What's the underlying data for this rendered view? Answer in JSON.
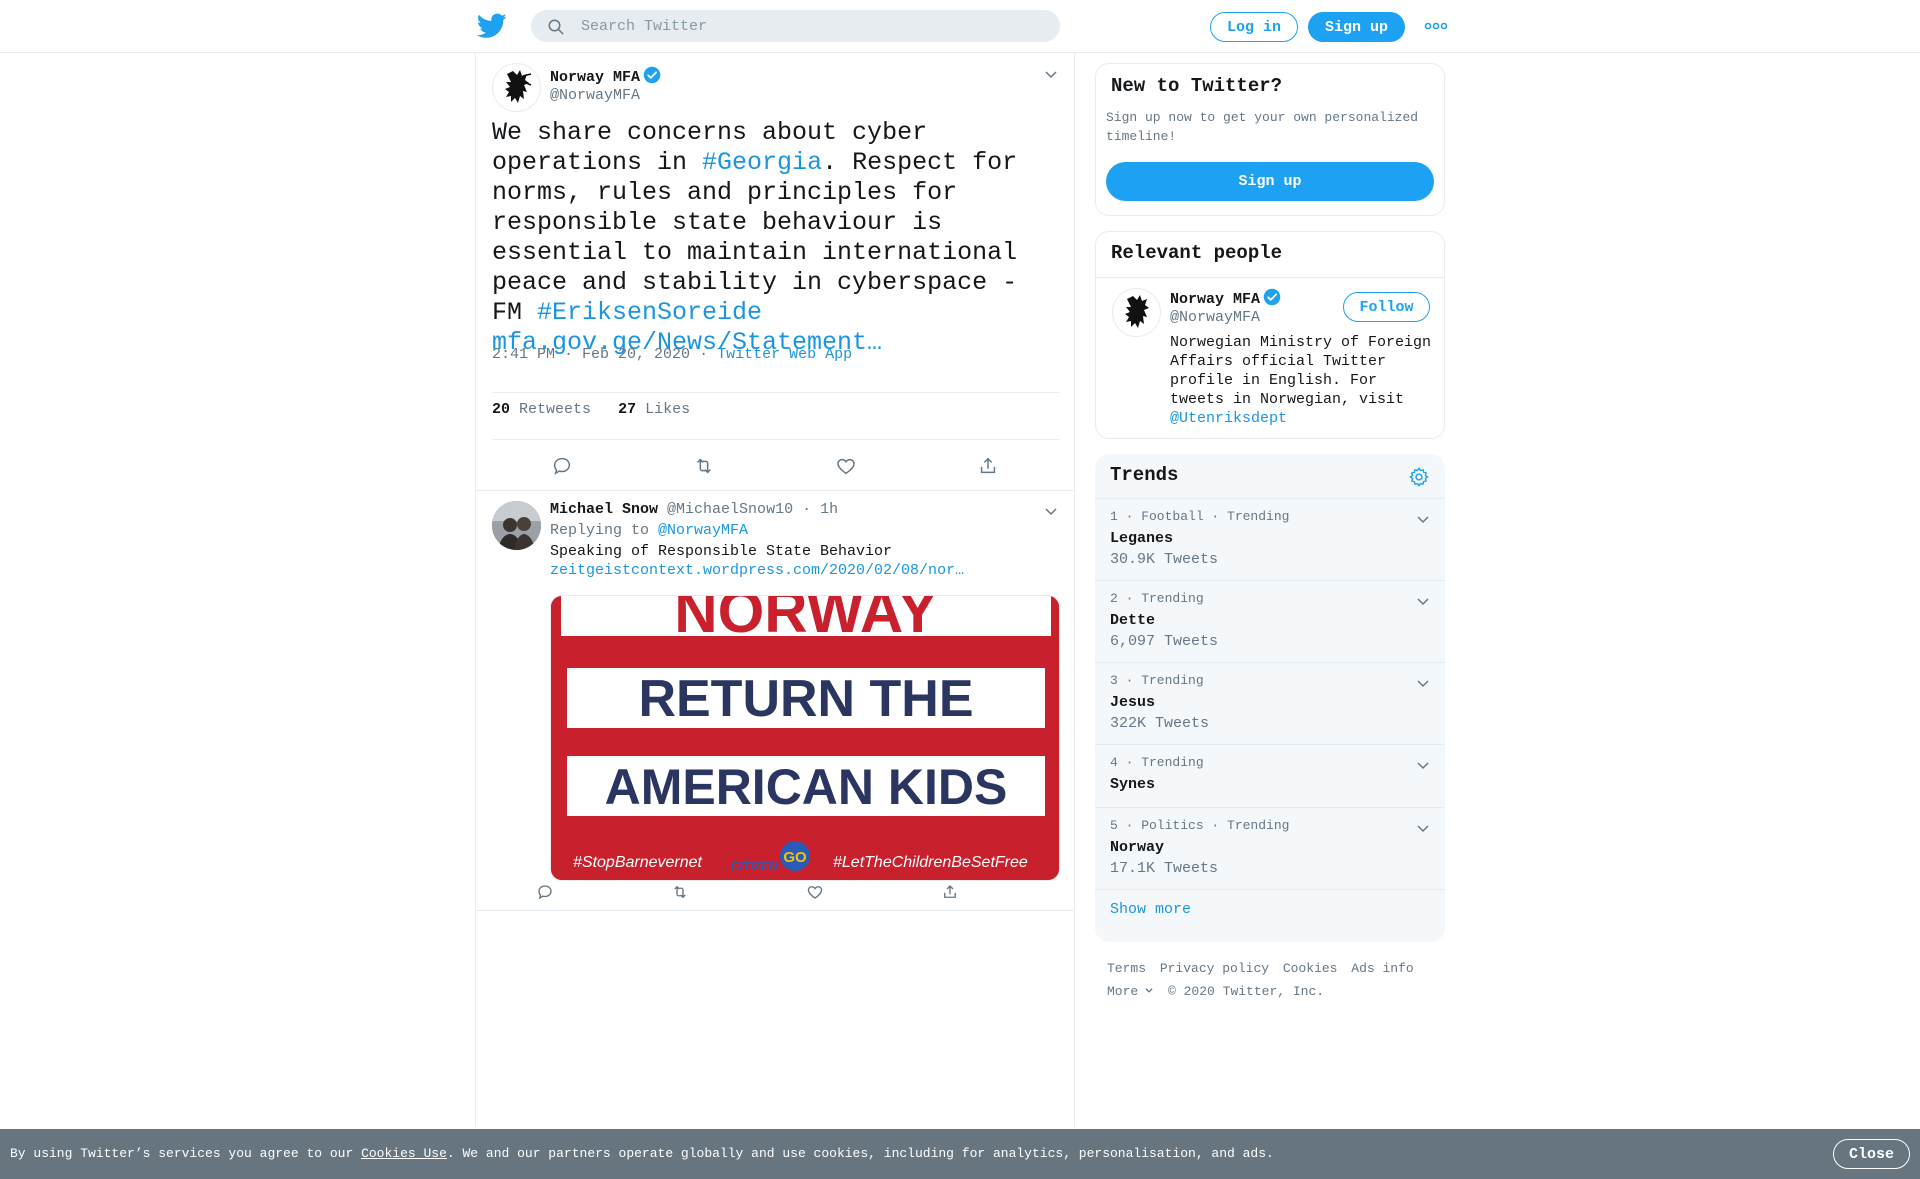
{
  "header": {
    "search_placeholder": "Search Twitter",
    "login_label": "Log in",
    "signup_label": "Sign up"
  },
  "tweet": {
    "author_name": "Norway MFA",
    "author_handle": "@NorwayMFA",
    "text_1": "We share concerns about cyber operations in ",
    "hashtag_1": "#Georgia",
    "text_2": ". Respect for norms, rules and principles for responsible state behaviour is essential to maintain international peace and stability in cyberspace - FM ",
    "hashtag_2": "#EriksenSoreide",
    "link": "mfa.gov.ge/News/Statement…",
    "time": "2:41 PM · Feb 20, 2020",
    "sep": "·",
    "source": "Twitter Web App",
    "retweets_count": "20",
    "retweets_label": "Retweets",
    "likes_count": "27",
    "likes_label": "Likes"
  },
  "reply": {
    "author_name": "Michael Snow",
    "author_handle": "@MichaelSnow10",
    "age": "· 1h",
    "replying_prefix": "Replying to",
    "replying_to": "@NorwayMFA",
    "text": "Speaking of Responsible State Behavior",
    "link": "zeitgeistcontext.wordpress.com/2020/02/08/nor…",
    "image": {
      "top_text": "NORWAY",
      "line1": "RETURN THE",
      "line2": "AMERICAN KIDS",
      "tag_left": "#StopBarnevernet",
      "logo_text": "CITIZEN",
      "logo_go": "GO",
      "tag_right": "#LetTheChildrenBeSetFree"
    }
  },
  "sidebar": {
    "new_title": "New to Twitter?",
    "new_desc": "Sign up now to get your own personalized timeline!",
    "signup_label": "Sign up",
    "relevant_title": "Relevant people",
    "person_name": "Norway MFA",
    "person_handle": "@NorwayMFA",
    "follow_label": "Follow",
    "bio_text": "Norwegian Ministry of Foreign Affairs official Twitter profile in English. For tweets in Norwegian, visit ",
    "bio_link": "@Utenriksdept",
    "trends_title": "Trends",
    "trends": [
      {
        "context": "1 · Football · Trending",
        "name": "Leganes",
        "count": "30.9K Tweets"
      },
      {
        "context": "2 · Trending",
        "name": "Dette",
        "count": "6,097 Tweets"
      },
      {
        "context": "3 · Trending",
        "name": "Jesus",
        "count": "322K Tweets"
      },
      {
        "context": "4 · Trending",
        "name": "Synes",
        "count": ""
      },
      {
        "context": "5 · Politics · Trending",
        "name": "Norway",
        "count": "17.1K Tweets"
      }
    ],
    "show_more": "Show more",
    "footer": {
      "terms": "Terms",
      "privacy": "Privacy policy",
      "cookies": "Cookies",
      "ads": "Ads info",
      "more": "More",
      "copyright": "© 2020 Twitter, Inc."
    }
  },
  "cookie_bar": {
    "prefix": "By using Twitter’s services you agree to our ",
    "link": "Cookies Use",
    "suffix": ". We and our partners operate globally and use cookies, including for analytics, personalisation, and ads.",
    "close_label": "Close"
  },
  "colors": {
    "accent": "#1da1f2",
    "link": "#1b95e0",
    "cookie_bg": "#66757f",
    "banner_red": "#c9202d",
    "banner_navy": "#2a3560"
  }
}
